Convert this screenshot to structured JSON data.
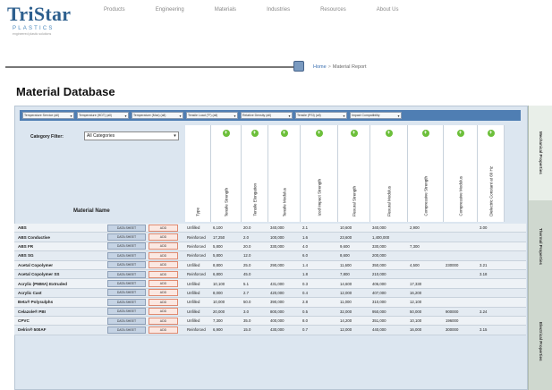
{
  "brand": {
    "name": "TriStar",
    "sub": "PLASTICS",
    "tagline": "engineered plastic solutions"
  },
  "nav": [
    "Products",
    "Engineering",
    "Materials",
    "Industries",
    "Resources",
    "About Us"
  ],
  "breadcrumb": {
    "home": "Home",
    "separator": ">",
    "current": "Material Report"
  },
  "page_title": "Material Database",
  "filters": [
    "Temperature Service (all)",
    "Temperature (HDT) (all)",
    "Temperature (Max) (all)",
    "Tensile Load (°F) (all)",
    "Relative Density (all)",
    "Tensile (PSI) (all)",
    "Impact Compatibility"
  ],
  "category_filter": {
    "label": "Category Filter:",
    "value": "All Categories"
  },
  "material_name_header": "Material Name",
  "columns": [
    "Type",
    "Tensile Strength",
    "Tensile Elongation",
    "Tensile Modulus",
    "Izod Impact Strength",
    "Flexural Strength",
    "Flexural Modulus",
    "Compressive Strength",
    "Compressive Modulus",
    "Dielectric Constant at 60 Hz"
  ],
  "buttons": {
    "details": "DATA SHEET",
    "compare": "ADD"
  },
  "rows": [
    {
      "name": "ABS",
      "values": [
        "Unfilled",
        "6,100",
        "20.0",
        "340,000",
        "2.1",
        "10,600",
        "340,000",
        "2,900",
        "",
        "3.00"
      ]
    },
    {
      "name": "ABS Conductive",
      "values": [
        "Reinforced",
        "17,250",
        "2.0",
        "100,000",
        "1.6",
        "23,600",
        "1,400,000",
        "",
        "",
        ""
      ]
    },
    {
      "name": "ABS FR",
      "values": [
        "Reinforced",
        "5,800",
        "20.0",
        "330,000",
        "4.0",
        "9,600",
        "330,000",
        "7,300",
        "",
        ""
      ]
    },
    {
      "name": "ABS SG",
      "values": [
        "Reinforced",
        "5,800",
        "12.0",
        "",
        "6.0",
        "8,600",
        "200,000",
        "",
        "",
        ""
      ]
    },
    {
      "name": "Acetal Copolymer",
      "values": [
        "Unfilled",
        "8,800",
        "25.0",
        "290,000",
        "1.4",
        "11,600",
        "350,000",
        "4,500",
        "230000",
        "3.21"
      ]
    },
    {
      "name": "Acetal Copolymer SS",
      "values": [
        "Reinforced",
        "6,800",
        "45.0",
        "",
        "1.8",
        "7,800",
        "210,000",
        "",
        "",
        "3.18"
      ]
    },
    {
      "name": "Acrylic (PMMA) Extruded",
      "values": [
        "Unfilled",
        "10,100",
        "5.1",
        "431,000",
        "0.3",
        "14,600",
        "406,000",
        "17,330",
        "",
        ""
      ]
    },
    {
      "name": "Acrylic Cast",
      "values": [
        "Unfilled",
        "8,000",
        "2.7",
        "420,000",
        "0.4",
        "12,000",
        "407,000",
        "16,200",
        "",
        ""
      ]
    },
    {
      "name": "Beta® Polysulphs",
      "values": [
        "Unfilled",
        "10,000",
        "50.0",
        "390,000",
        "2.8",
        "11,000",
        "310,000",
        "12,100",
        "",
        ""
      ]
    },
    {
      "name": "Celazole® PBI",
      "values": [
        "Unfilled",
        "20,000",
        "3.0",
        "800,000",
        "0.5",
        "32,000",
        "950,000",
        "50,000",
        "900000",
        "3.24"
      ]
    },
    {
      "name": "CPVC",
      "values": [
        "Unfilled",
        "7,300",
        "35.0",
        "400,000",
        "8.0",
        "14,200",
        "351,000",
        "10,100",
        "196000",
        ""
      ]
    },
    {
      "name": "Delrin® 500AF",
      "values": [
        "Reinforced",
        "6,900",
        "15.0",
        "430,000",
        "0.7",
        "12,000",
        "440,000",
        "16,000",
        "300000",
        "3.15"
      ]
    }
  ],
  "side_tabs": [
    "Mechanical Properties",
    "Thermal Properties",
    "Electrical Properties"
  ]
}
